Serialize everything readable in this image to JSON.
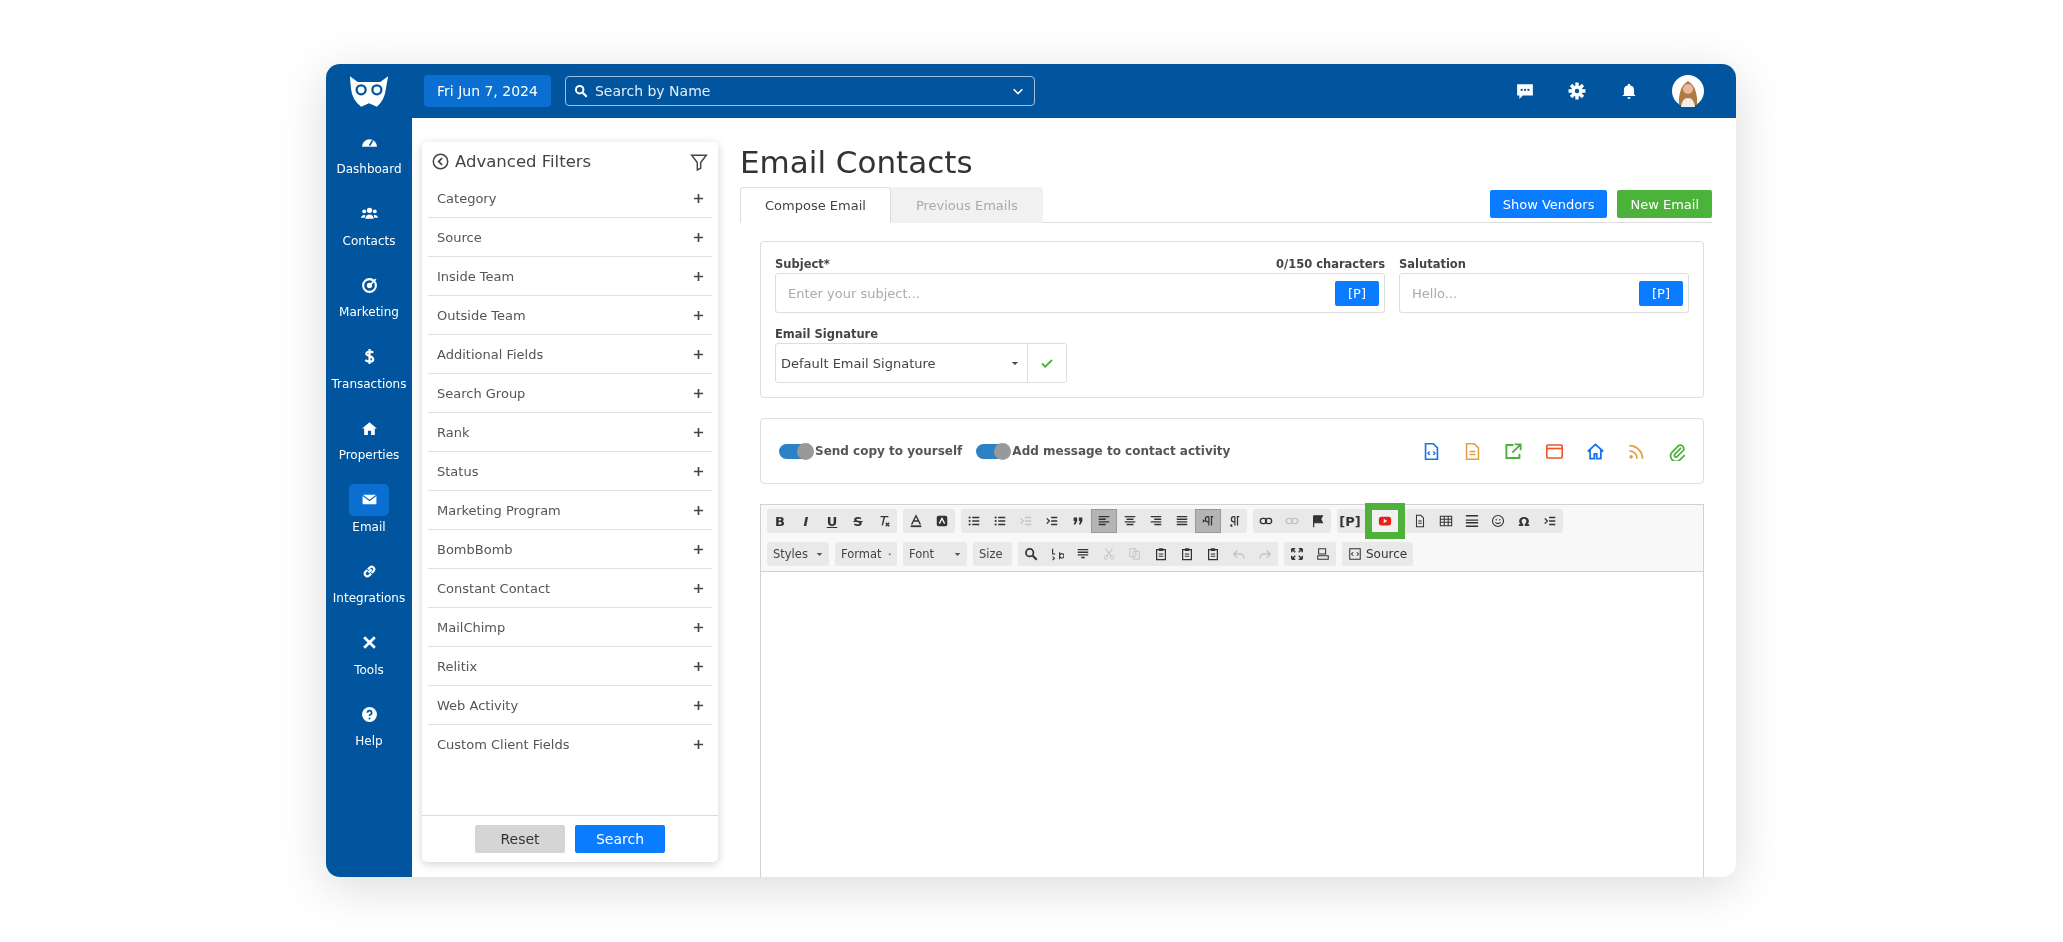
{
  "top_bar": {
    "date": "Fri Jun 7, 2024",
    "search": {
      "placeholder": "Search by Name"
    }
  },
  "sidebar": {
    "items": [
      {
        "label": "Dashboard",
        "kind": "gauge",
        "selected": false
      },
      {
        "label": "Contacts",
        "kind": "people",
        "selected": false
      },
      {
        "label": "Marketing",
        "kind": "target",
        "selected": false
      },
      {
        "label": "Transactions",
        "kind": "dollar",
        "selected": false
      },
      {
        "label": "Properties",
        "kind": "house",
        "selected": false
      },
      {
        "label": "Email",
        "kind": "envelope",
        "selected": true
      },
      {
        "label": "Integrations",
        "kind": "link",
        "selected": false
      },
      {
        "label": "Tools",
        "kind": "tools",
        "selected": false
      },
      {
        "label": "Help",
        "kind": "help",
        "selected": false
      }
    ]
  },
  "filters": {
    "title": "Advanced Filters",
    "items": [
      "Category",
      "Source",
      "Inside Team",
      "Outside Team",
      "Additional Fields",
      "Search Group",
      "Rank",
      "Status",
      "Marketing Program",
      "BombBomb",
      "Constant Contact",
      "MailChimp",
      "Relitix",
      "Web Activity",
      "Custom Client Fields"
    ],
    "buttons": {
      "reset": "Reset",
      "search": "Search"
    }
  },
  "page": {
    "title": "Email Contacts",
    "tabs": [
      {
        "label": "Compose Email",
        "selected": true
      },
      {
        "label": "Previous Emails",
        "selected": false
      }
    ],
    "actions": {
      "show_vendors": "Show Vendors",
      "new_email": "New Email"
    }
  },
  "compose": {
    "subject": {
      "label": "Subject*",
      "counter": "0/150 characters",
      "placeholder": "Enter your subject...",
      "token": "[P]"
    },
    "salutation": {
      "label": "Salutation",
      "placeholder": "Hello...",
      "token": "[P]"
    },
    "signature": {
      "label": "Email Signature",
      "value": "Default Email Signature"
    }
  },
  "options": {
    "toggles": [
      {
        "label": "Send copy to yourself",
        "on": true
      },
      {
        "label": "Add message to contact activity",
        "on": true
      }
    ]
  },
  "editor": {
    "toolbar_rows": [
      [
        [
          {
            "kind": "text",
            "label": "B",
            "on": false,
            "disabled": false,
            "highlighted": false
          },
          {
            "kind": "text",
            "label": "I",
            "on": false,
            "disabled": false,
            "highlighted": false
          },
          {
            "kind": "text",
            "label": "U",
            "on": false,
            "disabled": false,
            "highlighted": false
          },
          {
            "kind": "text",
            "label": "S",
            "on": false,
            "disabled": false,
            "highlighted": false
          },
          {
            "kind": "clearformat",
            "on": false,
            "disabled": false,
            "highlighted": false
          }
        ],
        [
          {
            "kind": "textcolor",
            "on": false,
            "disabled": false,
            "highlighted": false
          },
          {
            "kind": "bgcolor",
            "on": false,
            "disabled": false,
            "highlighted": false
          }
        ],
        [
          {
            "kind": "numlist",
            "on": false,
            "disabled": false,
            "highlighted": false
          },
          {
            "kind": "bullist",
            "on": false,
            "disabled": false,
            "highlighted": false
          },
          {
            "kind": "outdent",
            "on": false,
            "disabled": true,
            "highlighted": false
          },
          {
            "kind": "indent",
            "on": false,
            "disabled": false,
            "highlighted": false
          },
          {
            "kind": "quote",
            "on": false,
            "disabled": false,
            "highlighted": false
          },
          {
            "kind": "alignleft",
            "on": true,
            "disabled": false,
            "highlighted": false
          },
          {
            "kind": "aligncenter",
            "on": false,
            "disabled": false,
            "highlighted": false
          },
          {
            "kind": "alignright",
            "on": false,
            "disabled": false,
            "highlighted": false
          },
          {
            "kind": "justify",
            "on": false,
            "disabled": false,
            "highlighted": false
          },
          {
            "kind": "ltr",
            "on": true,
            "disabled": false,
            "highlighted": false
          },
          {
            "kind": "rtl",
            "on": false,
            "disabled": false,
            "highlighted": false
          }
        ],
        [
          {
            "kind": "link",
            "on": false,
            "disabled": false,
            "highlighted": false
          },
          {
            "kind": "unlink",
            "on": false,
            "disabled": true,
            "highlighted": false
          },
          {
            "kind": "flag",
            "on": false,
            "disabled": false,
            "highlighted": false
          }
        ],
        [
          {
            "kind": "text",
            "label": "[P]",
            "on": false,
            "disabled": false,
            "highlighted": false
          },
          {
            "kind": "video",
            "on": false,
            "disabled": false,
            "highlighted": true
          },
          {
            "kind": "document",
            "on": false,
            "disabled": false,
            "highlighted": false
          },
          {
            "kind": "table",
            "on": false,
            "disabled": false,
            "highlighted": false
          },
          {
            "kind": "rule",
            "on": false,
            "disabled": false,
            "highlighted": false
          },
          {
            "kind": "smiley",
            "on": false,
            "disabled": false,
            "highlighted": false
          },
          {
            "kind": "text",
            "label": "Ω",
            "on": false,
            "disabled": false,
            "highlighted": false
          },
          {
            "kind": "pagebreak",
            "on": false,
            "disabled": false,
            "highlighted": false
          }
        ]
      ],
      [
        [
          {
            "kind": "combo",
            "label": "Styles"
          }
        ],
        [
          {
            "kind": "combo",
            "label": "Format"
          }
        ],
        [
          {
            "kind": "combo",
            "label": "Font"
          }
        ],
        [
          {
            "kind": "combo",
            "label": "Size"
          }
        ],
        [
          {
            "kind": "find",
            "on": false,
            "disabled": false,
            "highlighted": false
          },
          {
            "kind": "replace",
            "on": false,
            "disabled": false,
            "highlighted": false
          },
          {
            "kind": "selectall",
            "on": false,
            "disabled": false,
            "highlighted": false
          },
          {
            "kind": "cut",
            "on": false,
            "disabled": true,
            "highlighted": false
          },
          {
            "kind": "copy",
            "on": false,
            "disabled": true,
            "highlighted": false
          },
          {
            "kind": "paste",
            "on": false,
            "disabled": false,
            "highlighted": false
          },
          {
            "kind": "pastetext",
            "on": false,
            "disabled": false,
            "highlighted": false
          },
          {
            "kind": "pasteword",
            "on": false,
            "disabled": false,
            "highlighted": false
          },
          {
            "kind": "undo",
            "on": false,
            "disabled": true,
            "highlighted": false
          },
          {
            "kind": "redo",
            "on": false,
            "disabled": true,
            "highlighted": false
          }
        ],
        [
          {
            "kind": "maximize",
            "on": false,
            "disabled": false,
            "highlighted": false
          },
          {
            "kind": "showblocks",
            "on": false,
            "disabled": false,
            "highlighted": false
          }
        ],
        [
          {
            "kind": "source",
            "label": "Source"
          }
        ]
      ]
    ]
  }
}
